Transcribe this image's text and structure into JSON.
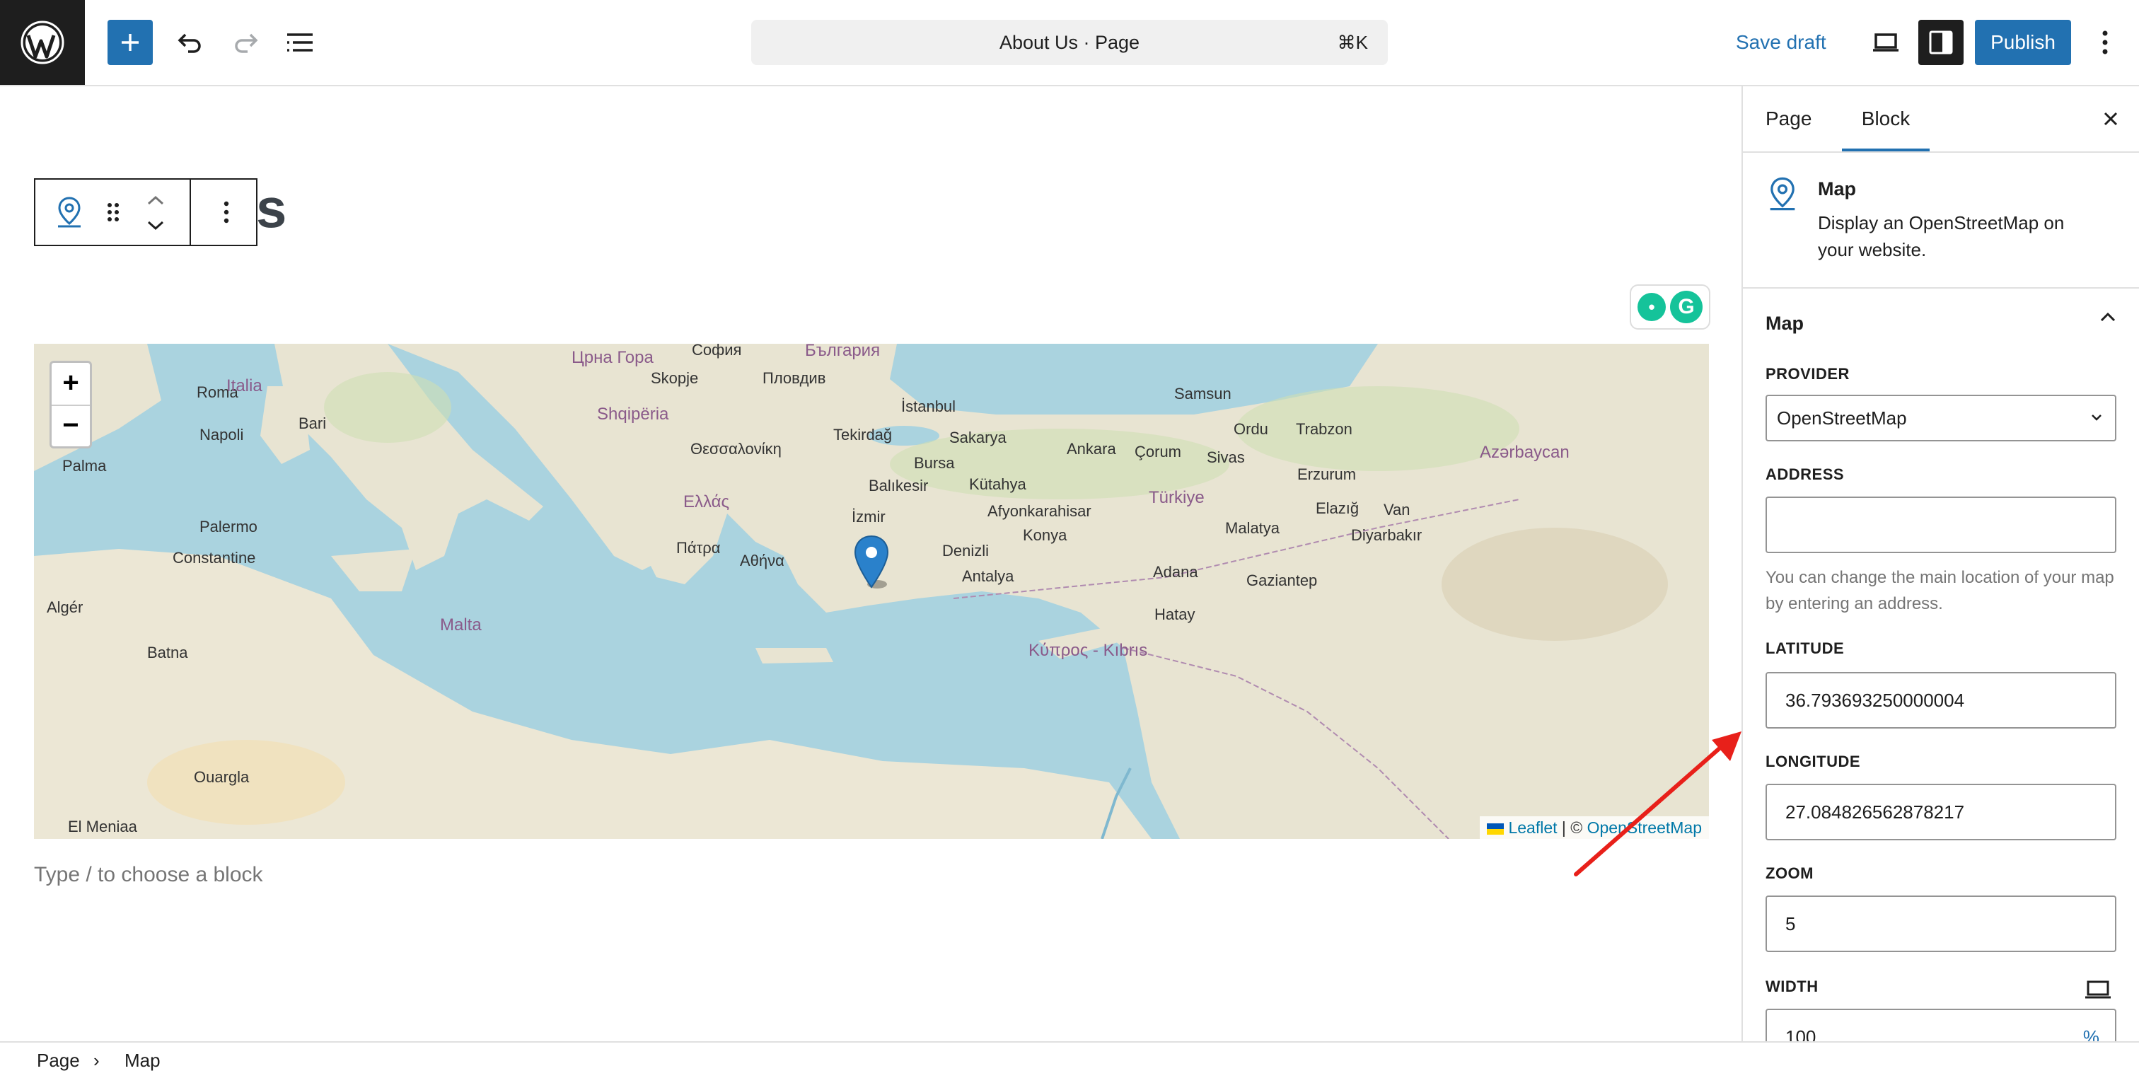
{
  "app": {
    "document_title": "About Us · Page",
    "shortcut": "⌘K",
    "save_draft_label": "Save draft",
    "publish_label": "Publish"
  },
  "editor": {
    "heading_fragment": "s",
    "placeholder": "Type / to choose a block",
    "map": {
      "zoom_in": "+",
      "zoom_out": "−",
      "attribution_leaflet": "Leaflet",
      "attribution_sep": " | © ",
      "attribution_osm": "OpenStreetMap",
      "labels": [
        "Roma",
        "Italia",
        "Napoli",
        "Bari",
        "Palermo",
        "Palma",
        "Constantine",
        "Algér",
        "Batna",
        "Malta",
        "Shqipëria",
        "Θεσσαλονίκη",
        "Ελλάς",
        "Πάτρα",
        "Αθήνα",
        "İstanbul",
        "Tekirdağ",
        "Bursa",
        "Sakarya",
        "Balıkesir",
        "İzmir",
        "Kütahya",
        "Ankara",
        "Çorum",
        "Samsun",
        "Ordu",
        "Trabzon",
        "Sivas",
        "Türkiye",
        "Afyonkarahisar",
        "Denizli",
        "Konya",
        "Antalya",
        "Adana",
        "Malatya",
        "Elazığ",
        "Diyarbakır",
        "Gaziantep",
        "Hatay",
        "Erzurum",
        "Van",
        "Azərbaycan",
        "Κύπρος - Kıbrıs",
        "Skopje",
        "Пловдив",
        "Црна Гора",
        "София",
        "България",
        "Samsun",
        "Ouargla",
        "El Meniaa"
      ]
    }
  },
  "sidebar": {
    "tabs": [
      "Page",
      "Block"
    ],
    "block": {
      "title": "Map",
      "description": "Display an OpenStreetMap on your website."
    },
    "panel_title": "Map",
    "fields": {
      "provider_label": "PROVIDER",
      "provider_value": "OpenStreetMap",
      "address_label": "ADDRESS",
      "address_value": "",
      "address_help": "You can change the main location of your map by entering an address.",
      "latitude_label": "LATITUDE",
      "latitude_value": "36.793693250000004",
      "longitude_label": "LONGITUDE",
      "longitude_value": "27.084826562878217",
      "zoom_label": "ZOOM",
      "zoom_value": "5",
      "width_label": "WIDTH",
      "width_value": "100",
      "width_unit": "%"
    }
  },
  "breadcrumb": {
    "items": [
      "Page",
      "Map"
    ],
    "separator": "›"
  },
  "colors": {
    "accent": "#2271b1",
    "sea": "#aad3df",
    "annotation_arrow": "#e8201a"
  }
}
